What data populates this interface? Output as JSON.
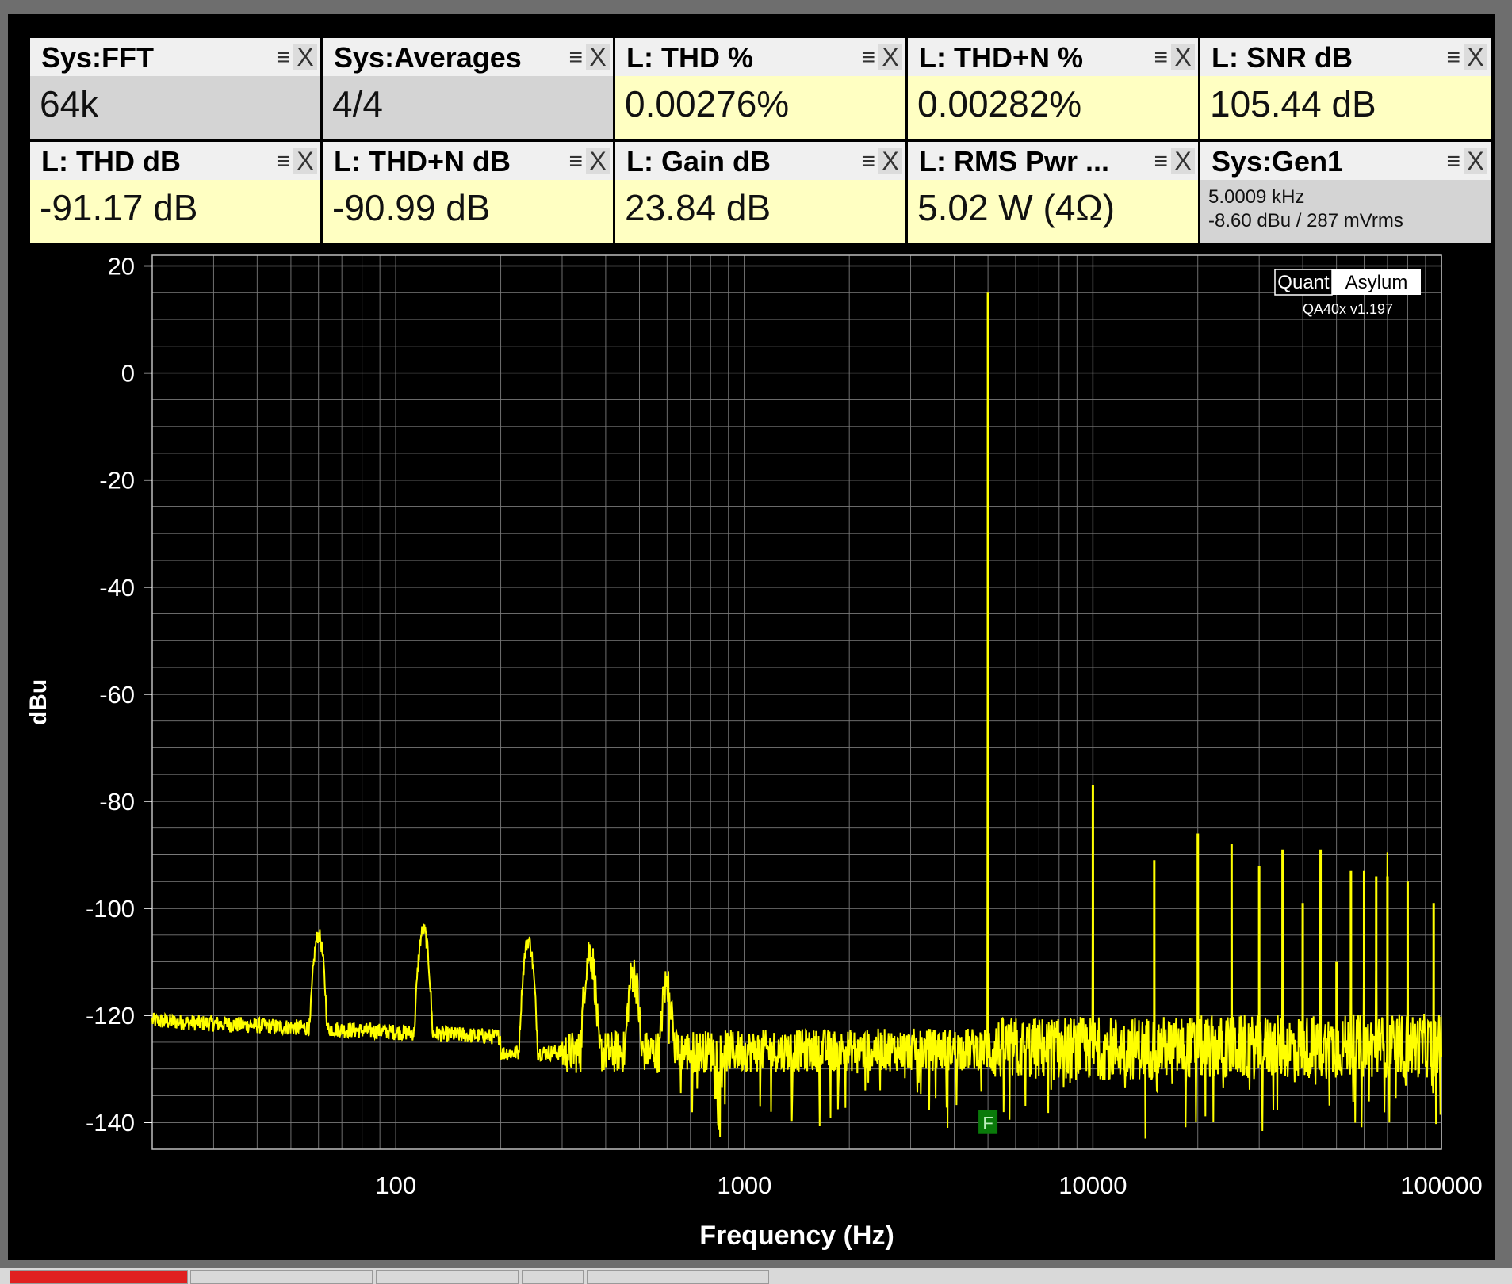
{
  "tiles": [
    {
      "title": "Sys:FFT",
      "value": "64k",
      "style": "gray"
    },
    {
      "title": "Sys:Averages",
      "value": "4/4",
      "style": "gray"
    },
    {
      "title": "L: THD %",
      "value": "0.00276%",
      "style": "yellow"
    },
    {
      "title": "L: THD+N %",
      "value": "0.00282%",
      "style": "yellow"
    },
    {
      "title": "L: SNR dB",
      "value": "105.44 dB",
      "style": "yellow"
    },
    {
      "title": "L: THD dB",
      "value": "-91.17 dB",
      "style": "yellow"
    },
    {
      "title": "L: THD+N dB",
      "value": "-90.99 dB",
      "style": "yellow"
    },
    {
      "title": "L: Gain dB",
      "value": "23.84 dB",
      "style": "yellow"
    },
    {
      "title": "L: RMS Pwr ...",
      "value": "5.02 W (4Ω)",
      "style": "yellow"
    },
    {
      "title": "Sys:Gen1",
      "line1": "5.0009 kHz",
      "line2": "-8.60 dBu  / 287 mVrms",
      "style": "gray"
    }
  ],
  "tile_icons": {
    "menu": "menu-icon",
    "close": "close-icon",
    "menu_glyph": "≡",
    "close_glyph": "X"
  },
  "brand": {
    "left": "Quant",
    "right": "Asylum",
    "version": "QA40x v1.197"
  },
  "marker": {
    "label": "F",
    "frequency_hz": 5000
  },
  "colors": {
    "trace": "#ffff00",
    "grid": "#7a7a7a",
    "background": "#000000",
    "marker": "#0a7a0a"
  },
  "chart_data": {
    "type": "line",
    "xlabel": "Frequency (Hz)",
    "ylabel": "dBu",
    "x_scale": "log",
    "xlim": [
      20,
      100000
    ],
    "ylim": [
      -145,
      22
    ],
    "x_ticks": [
      100,
      1000,
      10000,
      100000
    ],
    "x_tick_labels": [
      "100",
      "1000",
      "10000",
      "100000"
    ],
    "y_ticks": [
      20,
      0,
      -20,
      -40,
      -60,
      -80,
      -100,
      -120,
      -140
    ],
    "y_tick_labels": [
      "20",
      "0",
      "-20",
      "-40",
      "-60",
      "-80",
      "-100",
      "-120",
      "-140"
    ],
    "grid": true,
    "noise_floor_dbu": -126,
    "peaks": [
      {
        "f": 60,
        "db": -105
      },
      {
        "f": 120,
        "db": -104
      },
      {
        "f": 240,
        "db": -106
      },
      {
        "f": 360,
        "db": -108
      },
      {
        "f": 480,
        "db": -112
      },
      {
        "f": 600,
        "db": -114
      },
      {
        "f": 5000,
        "db": 15
      },
      {
        "f": 10000,
        "db": -77
      },
      {
        "f": 15000,
        "db": -91
      },
      {
        "f": 20000,
        "db": -86
      },
      {
        "f": 25000,
        "db": -88
      },
      {
        "f": 30000,
        "db": -92
      },
      {
        "f": 35000,
        "db": -89
      },
      {
        "f": 40000,
        "db": -99
      },
      {
        "f": 45000,
        "db": -89
      },
      {
        "f": 50000,
        "db": -110
      },
      {
        "f": 55000,
        "db": -93
      },
      {
        "f": 60000,
        "db": -93
      },
      {
        "f": 65000,
        "db": -94
      },
      {
        "f": 70000,
        "db": -94
      },
      {
        "f": 80000,
        "db": -95
      },
      {
        "f": 95000,
        "db": -99
      }
    ]
  }
}
